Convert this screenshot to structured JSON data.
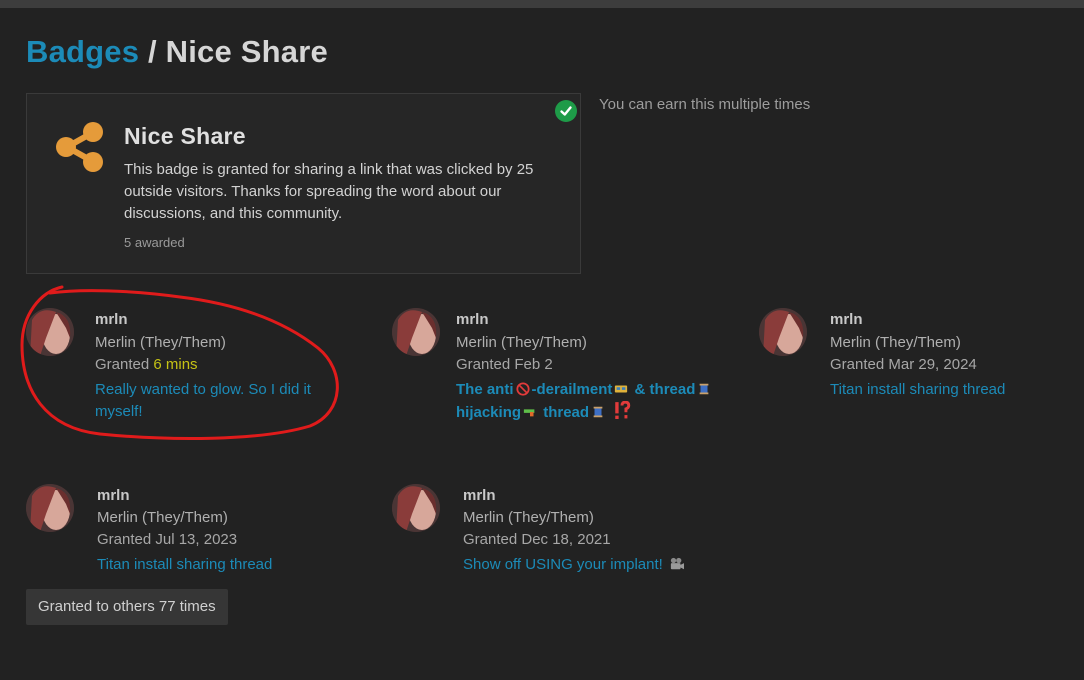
{
  "breadcrumb": {
    "parent": "Badges",
    "separator": " / ",
    "current": "Nice Share"
  },
  "badge": {
    "title": "Nice Share",
    "description": "This badge is granted for sharing a link that was clicked by 25 outside visitors. Thanks for spreading the word about our discussions, and this community.",
    "awarded": "5 awarded",
    "icon": "share-icon",
    "icon_color": "#e59b3a",
    "granted_check_color": "#1e9b48"
  },
  "multiple_note": "You can earn this multiple times",
  "awards": [
    {
      "username": "mrln",
      "name": "Merlin (They/Them)",
      "granted_prefix": "Granted ",
      "granted_when": "6 mins",
      "topic": "Really wanted to glow. So I did it myself!"
    },
    {
      "username": "mrln",
      "name": "Merlin (They/Them)",
      "granted_prefix": "Granted ",
      "granted_when": "Feb 2",
      "topic_parts": [
        "The anti",
        "-derailment",
        " & thread",
        "hijacking",
        " thread"
      ]
    },
    {
      "username": "mrln",
      "name": "Merlin (They/Them)",
      "granted_prefix": "Granted ",
      "granted_when": "Mar 29, 2024",
      "topic": "Titan install sharing thread"
    },
    {
      "username": "mrln",
      "name": "Merlin (They/Them)",
      "granted_prefix": "Granted ",
      "granted_when": "Jul 13, 2023",
      "topic": "Titan install sharing thread"
    },
    {
      "username": "mrln",
      "name": "Merlin (They/Them)",
      "granted_prefix": "Granted ",
      "granted_when": "Dec 18, 2021",
      "topic": "Show off USING your implant!"
    }
  ],
  "more_button": "Granted to others 77 times",
  "colors": {
    "link": "#1c8bb8",
    "background": "#222222",
    "highlight": "#c5c215",
    "annotation": "#e01b1b"
  }
}
